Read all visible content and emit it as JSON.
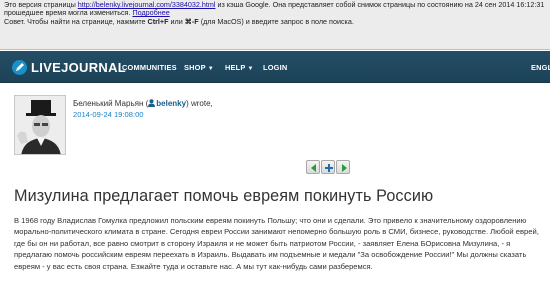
{
  "cache_banner": {
    "line1_prefix": "Это версия страницы ",
    "line1_url": "http://belenky.livejournal.com/3384032.html",
    "line1_suffix": " из кэша Google. Она представляет собой снимок страницы по состоянию на 24 сен 2014 16:12:31 GMT.",
    "line2_text": "прошедшее время могла измениться. ",
    "line2_link": "Подробнее",
    "line3_prefix": "Совет. Чтобы найти на странице, нажмите ",
    "line3_key1": "Ctrl+F",
    "line3_middle": " или ",
    "line3_key2": "⌘-F",
    "line3_suffix": " (для MacOS) и введите запрос в поле поиска."
  },
  "header": {
    "logo_icon": "livejournal-pencil-icon",
    "wordmark": "LIVEJOURNAL",
    "nav": {
      "communities": "COMMUNITIES",
      "shop": "SHOP",
      "help": "HELP",
      "login": "LOGIN",
      "lang": "ENGL"
    },
    "colors": {
      "bar": "#1f475e",
      "logo": "#1b8fc7"
    }
  },
  "entry": {
    "author_name": "Беленький Марьян (",
    "username": "belenky",
    "wrote": ") wrote,",
    "date": "2014-09-24 19:08:00"
  },
  "post": {
    "title": "Мизулина предлагает помочь евреям покинуть Россию",
    "body": "В 1968 году Владислав Гомулка предложил польским евреям покинуть Польшу; что они и сделали. Это привело к значительному оздоровлению морально-политического климата в стране. Сегодня евреи России занимают непомерно большую роль в СМИ, бизнесе, руководстве. Любой еврей, где бы он ни работал, все равно смотрит в сторону Израиля и не может быть патриотом России, - заявляет Елена БОрисовна Мизулина, - я предлагаю помочь российским евреям переехать в Израиль. Выдавать им подъемные и медали \"За освобождение России!\" Мы должны сказать евреям - у вас есть своя страна. Езжайте туда и оставьте нас. А мы тут как-нибудь сами разберемся."
  }
}
